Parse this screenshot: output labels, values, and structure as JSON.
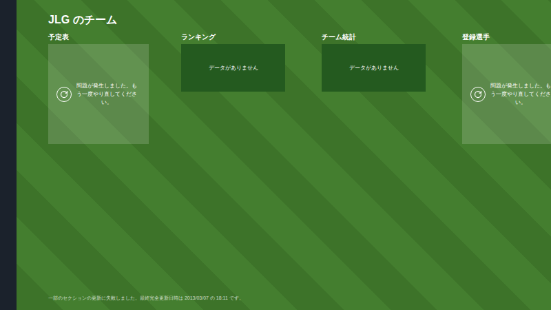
{
  "page": {
    "title": "JLG のチーム",
    "footer": "一部のセクションの更新に失敗しました。最終完全更新日時は 2013/03/07 の 18:11 です。"
  },
  "sections": [
    {
      "title": "予定表",
      "kind": "error",
      "message": "問題が発生しました。もう一度やり直してください。"
    },
    {
      "title": "ランキング",
      "kind": "empty",
      "message": "データがありません"
    },
    {
      "title": "チーム統計",
      "kind": "empty",
      "message": "データがありません"
    },
    {
      "title": "登録選手",
      "kind": "error",
      "message": "問題が発生しました。もう一度やり直してください。"
    }
  ]
}
